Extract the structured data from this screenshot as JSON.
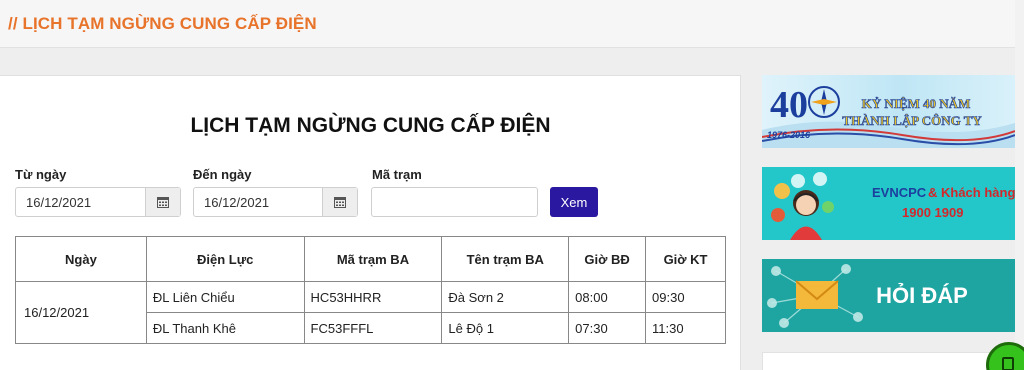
{
  "breadcrumb": "// LỊCH TẠM NGỪNG CUNG CẤP ĐIỆN",
  "page_title": "LỊCH TẠM NGỪNG CUNG CẤP ĐIỆN",
  "filters": {
    "from_label": "Từ ngày",
    "from_value": "16/12/2021",
    "to_label": "Đến ngày",
    "to_value": "16/12/2021",
    "station_label": "Mã trạm",
    "station_value": "",
    "search_button": "Xem"
  },
  "table": {
    "headers": [
      "Ngày",
      "Điện Lực",
      "Mã trạm BA",
      "Tên trạm BA",
      "Giờ BĐ",
      "Giờ KT"
    ],
    "date": "16/12/2021",
    "rows": [
      {
        "dien_luc": "ĐL Liên Chiểu",
        "ma_tram": "HC53HHRR",
        "ten_tram": "Đà Sơn 2",
        "gio_bd": "08:00",
        "gio_kt": "09:30"
      },
      {
        "dien_luc": "ĐL Thanh Khê",
        "ma_tram": "FC53FFFL",
        "ten_tram": "Lê Độ 1",
        "gio_bd": "07:30",
        "gio_kt": "11:30"
      }
    ]
  },
  "sidebar": {
    "banner1": {
      "line1": "KỶ NIỆM 40 NĂM",
      "line2": "THÀNH LẬP CÔNG TY",
      "years": "1976-2016",
      "logo_text": "40"
    },
    "banner2": {
      "title_a": "EVNCPC",
      "title_b": "& Khách hàng",
      "phone": "1900 1909"
    },
    "banner3": {
      "title": "HỎI ĐÁP"
    }
  },
  "colors": {
    "accent_orange": "#e8742b",
    "button_blue": "#2a18a0",
    "banner_teal": "#24c7c9",
    "banner_green": "#1ea5a1"
  }
}
